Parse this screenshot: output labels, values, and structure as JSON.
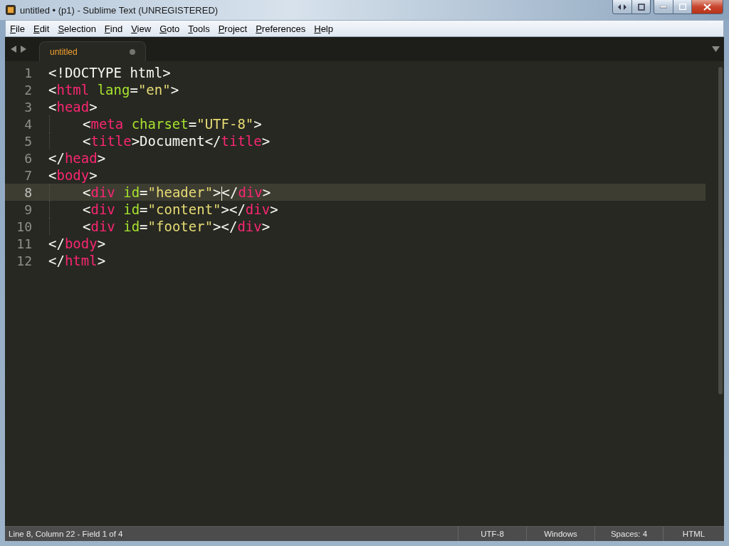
{
  "window": {
    "title": "untitled • (p1) - Sublime Text (UNREGISTERED)"
  },
  "menu": [
    "File",
    "Edit",
    "Selection",
    "Find",
    "View",
    "Goto",
    "Tools",
    "Project",
    "Preferences",
    "Help"
  ],
  "tabs": [
    {
      "label": "untitled",
      "selected": true,
      "dirty": true
    }
  ],
  "editor": {
    "lines": [
      {
        "number": "1",
        "current": false,
        "indented": false,
        "tokens": [
          {
            "kind": "text",
            "text": "<!DOCTYPE html>"
          }
        ]
      },
      {
        "number": "2",
        "current": false,
        "indented": false,
        "tokens": [
          {
            "kind": "punct",
            "text": "<"
          },
          {
            "kind": "tag",
            "text": "html"
          },
          {
            "kind": "attr",
            "text": " lang"
          },
          {
            "kind": "punct",
            "text": "="
          },
          {
            "kind": "string",
            "text": "\"en\""
          },
          {
            "kind": "punct",
            "text": ">"
          }
        ]
      },
      {
        "number": "3",
        "current": false,
        "indented": false,
        "tokens": [
          {
            "kind": "punct",
            "text": "<"
          },
          {
            "kind": "tag",
            "text": "head"
          },
          {
            "kind": "punct",
            "text": ">"
          }
        ]
      },
      {
        "number": "4",
        "current": false,
        "indented": true,
        "tokens": [
          {
            "kind": "punct",
            "text": "<"
          },
          {
            "kind": "tag",
            "text": "meta"
          },
          {
            "kind": "attr",
            "text": " charset"
          },
          {
            "kind": "punct",
            "text": "="
          },
          {
            "kind": "string",
            "text": "\"UTF-8\""
          },
          {
            "kind": "punct",
            "text": ">"
          }
        ]
      },
      {
        "number": "5",
        "current": false,
        "indented": true,
        "tokens": [
          {
            "kind": "punct",
            "text": "<"
          },
          {
            "kind": "tag",
            "text": "title"
          },
          {
            "kind": "punct",
            "text": ">"
          },
          {
            "kind": "text",
            "text": "Document"
          },
          {
            "kind": "punct",
            "text": "</"
          },
          {
            "kind": "tag",
            "text": "title"
          },
          {
            "kind": "punct",
            "text": ">"
          }
        ]
      },
      {
        "number": "6",
        "current": false,
        "indented": false,
        "tokens": [
          {
            "kind": "punct",
            "text": "</"
          },
          {
            "kind": "tag",
            "text": "head"
          },
          {
            "kind": "punct",
            "text": ">"
          }
        ]
      },
      {
        "number": "7",
        "current": false,
        "indented": false,
        "tokens": [
          {
            "kind": "punct",
            "text": "<"
          },
          {
            "kind": "tag",
            "text": "body"
          },
          {
            "kind": "punct",
            "text": ">"
          }
        ]
      },
      {
        "number": "8",
        "current": true,
        "indented": true,
        "tokens": [
          {
            "kind": "punct",
            "text": "<"
          },
          {
            "kind": "tag",
            "text": "div"
          },
          {
            "kind": "attr",
            "text": " id"
          },
          {
            "kind": "punct",
            "text": "="
          },
          {
            "kind": "string",
            "text": "\"header\""
          },
          {
            "kind": "punct",
            "text": ">"
          },
          {
            "kind": "caret"
          },
          {
            "kind": "punct",
            "text": "</"
          },
          {
            "kind": "tag",
            "text": "div"
          },
          {
            "kind": "punct",
            "text": ">"
          }
        ]
      },
      {
        "number": "9",
        "current": false,
        "indented": true,
        "tokens": [
          {
            "kind": "punct",
            "text": "<"
          },
          {
            "kind": "tag",
            "text": "div"
          },
          {
            "kind": "attr",
            "text": " id"
          },
          {
            "kind": "punct",
            "text": "="
          },
          {
            "kind": "string",
            "text": "\"content\""
          },
          {
            "kind": "punct",
            "text": "></"
          },
          {
            "kind": "tag",
            "text": "div"
          },
          {
            "kind": "punct",
            "text": ">"
          }
        ]
      },
      {
        "number": "10",
        "current": false,
        "indented": true,
        "tokens": [
          {
            "kind": "punct",
            "text": "<"
          },
          {
            "kind": "tag",
            "text": "div"
          },
          {
            "kind": "attr",
            "text": " id"
          },
          {
            "kind": "punct",
            "text": "="
          },
          {
            "kind": "string",
            "text": "\"footer\""
          },
          {
            "kind": "punct",
            "text": "></"
          },
          {
            "kind": "tag",
            "text": "div"
          },
          {
            "kind": "punct",
            "text": ">"
          }
        ]
      },
      {
        "number": "11",
        "current": false,
        "indented": false,
        "tokens": [
          {
            "kind": "punct",
            "text": "</"
          },
          {
            "kind": "tag",
            "text": "body"
          },
          {
            "kind": "punct",
            "text": ">"
          }
        ]
      },
      {
        "number": "12",
        "current": false,
        "indented": false,
        "tokens": [
          {
            "kind": "punct",
            "text": "</"
          },
          {
            "kind": "tag",
            "text": "html"
          },
          {
            "kind": "punct",
            "text": ">"
          }
        ]
      }
    ]
  },
  "status_bar": {
    "position": "Line 8, Column 22 - Field 1 of 4",
    "items": [
      "UTF-8",
      "Windows",
      "Spaces: 4",
      "HTML"
    ]
  }
}
